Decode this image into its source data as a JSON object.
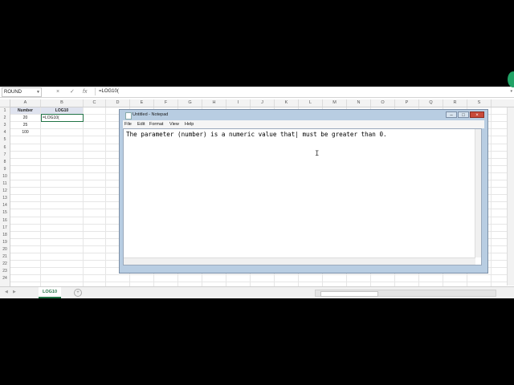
{
  "excel": {
    "name_box": "ROUND",
    "formula_icons": [
      "×",
      "✓",
      "fx"
    ],
    "formula_value": "=LOG10(",
    "columns": [
      "A",
      "B",
      "C",
      "D",
      "E",
      "F",
      "G",
      "H",
      "I",
      "J",
      "K",
      "L",
      "M",
      "N",
      "O",
      "P",
      "Q",
      "R",
      "S"
    ],
    "rows": [
      "1",
      "2",
      "3",
      "4",
      "5",
      "6",
      "7",
      "8",
      "9",
      "10",
      "11",
      "12",
      "13",
      "14",
      "15",
      "16",
      "17",
      "18",
      "19",
      "20",
      "21",
      "22",
      "23",
      "24"
    ],
    "cells": {
      "A1": "Number",
      "B1": "LOG10",
      "A2": "20",
      "B2": "=LOG10(",
      "A3": "25",
      "A4": "100"
    },
    "sheet_tab": "LOG10",
    "add_sheet": "+"
  },
  "notepad": {
    "title": "Untitled - Notepad",
    "buttons": [
      "–",
      "□",
      "×"
    ],
    "menus": [
      "File",
      "Edit",
      "Format",
      "View",
      "Help"
    ],
    "text": "The parameter (number) is a numeric value that| must be greater than 0."
  },
  "colors": {
    "excel_green": "#217346",
    "header_fill": "#dfe3ef",
    "notepad_frame": "#b8cde2"
  }
}
